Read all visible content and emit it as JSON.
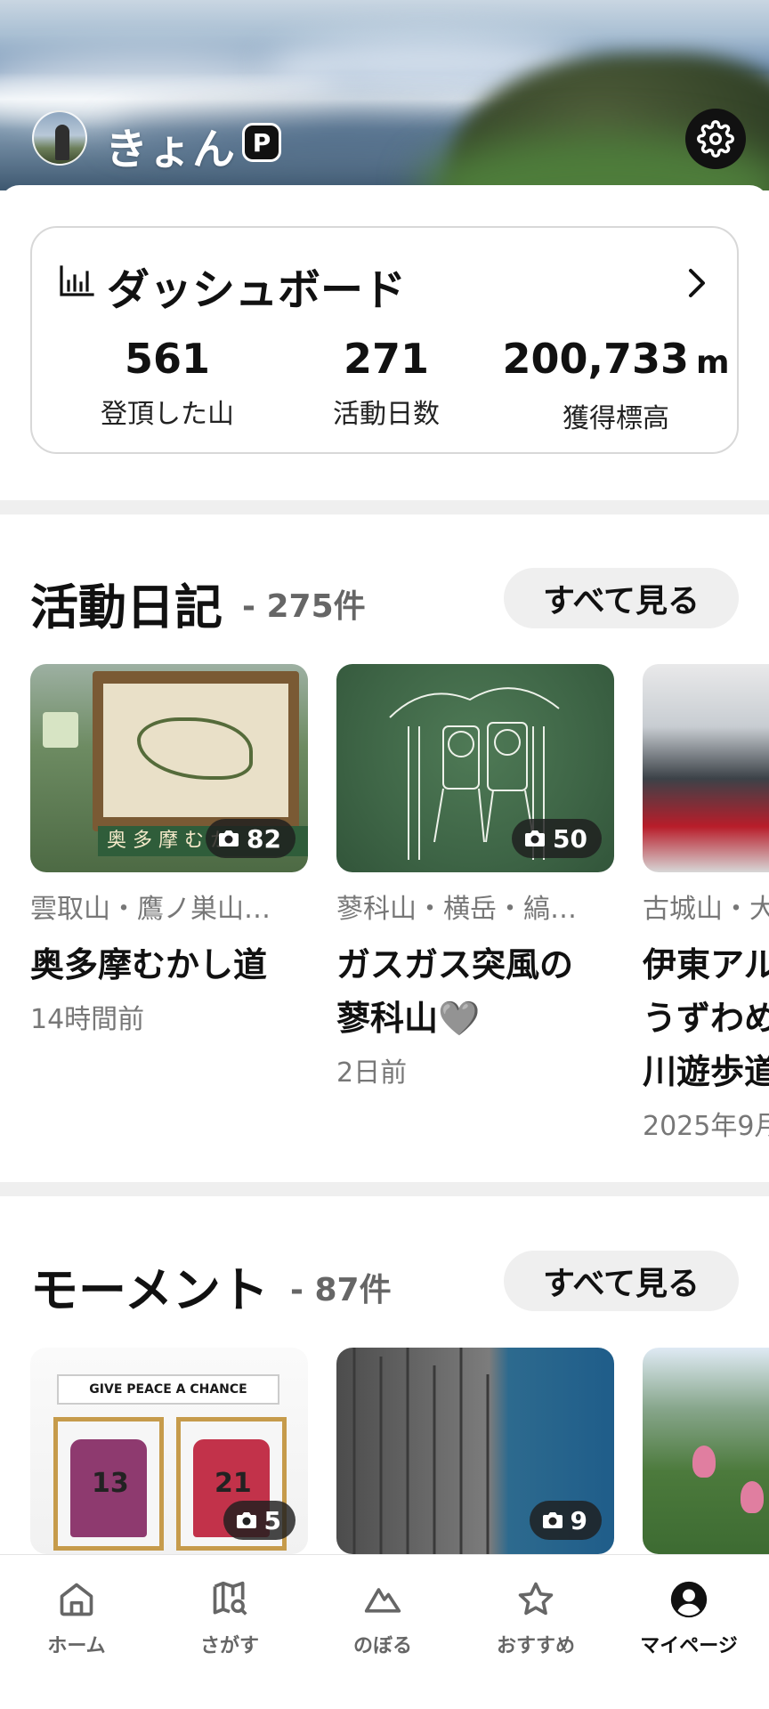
{
  "profile": {
    "username": "きょん",
    "premium_badge": "P"
  },
  "dashboard": {
    "title": "ダッシュボード",
    "stats": [
      {
        "value": "561",
        "unit": "",
        "label": "登頂した山"
      },
      {
        "value": "271",
        "unit": "",
        "label": "活動日数"
      },
      {
        "value": "200,733",
        "unit": "m",
        "label": "獲得標高"
      }
    ]
  },
  "diary": {
    "title": "活動日記",
    "count": "- 275件",
    "see_all": "すべて見る",
    "items": [
      {
        "photo_count": "82",
        "sign_text": "奥 多 摩  む か",
        "mountains": "雲取山・鷹ノ巣山…",
        "title": "奥多摩むかし道",
        "time": "14時間前"
      },
      {
        "photo_count": "50",
        "mountains": "蓼科山・横岳・縞…",
        "title_line1": "ガスガス突風の",
        "title_line2": "蓼科山🩶",
        "time": "2日前"
      },
      {
        "mountains": "古城山・大",
        "title_line1": "伊東アル",
        "title_line2": "うずわめ",
        "title_line3": "川遊歩道",
        "time": "2025年9月"
      }
    ]
  },
  "moments": {
    "title": "モーメント",
    "count": "- 87件",
    "see_all": "すべて見る",
    "items": [
      {
        "photo_count": "5",
        "banner_text": "GIVE PEACE A CHANCE",
        "num_left": "13",
        "num_right": "21"
      },
      {
        "photo_count": "9"
      },
      {}
    ]
  },
  "nav": {
    "items": [
      {
        "label": "ホーム",
        "icon": "home-icon"
      },
      {
        "label": "さがす",
        "icon": "map-search-icon"
      },
      {
        "label": "のぼる",
        "icon": "mountain-icon"
      },
      {
        "label": "おすすめ",
        "icon": "star-icon"
      },
      {
        "label": "マイページ",
        "icon": "user-circle-icon"
      }
    ],
    "active_index": 4
  },
  "colors": {
    "accent": "#111111",
    "secondary_text": "#777777",
    "chip_bg": "#efefef",
    "divider": "#efefef"
  }
}
